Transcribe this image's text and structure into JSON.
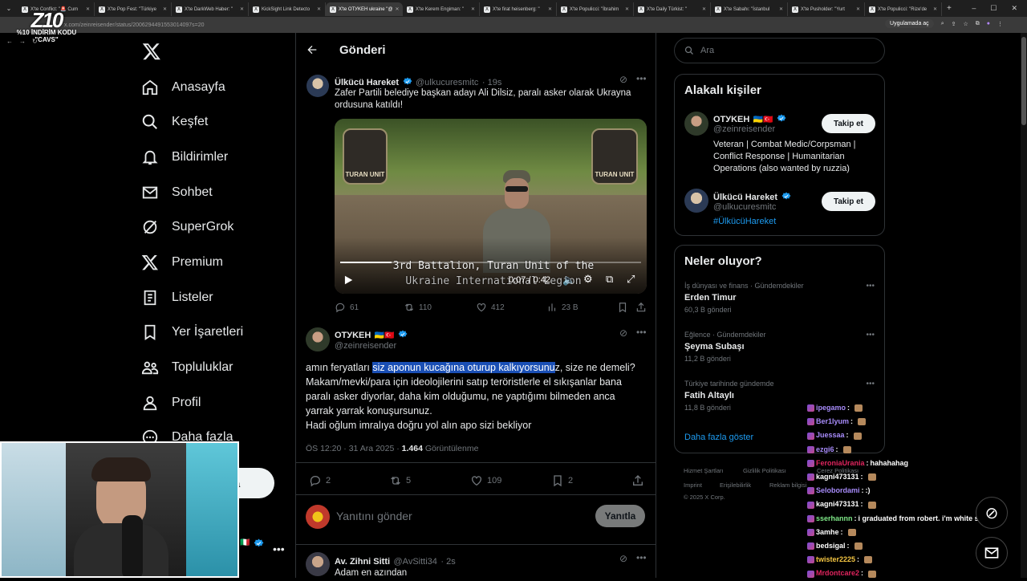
{
  "browser": {
    "tabs": [
      {
        "title": "X'te Conflict: \"🚨 Cum",
        "active": false
      },
      {
        "title": "X'te Pop Fest: \"Türkiye",
        "active": false
      },
      {
        "title": "X'te DarkWeb Haber: \"",
        "active": false
      },
      {
        "title": "KickSight Link Detecto",
        "active": false
      },
      {
        "title": "X'te OTУKEH ukraine \"@",
        "active": true
      },
      {
        "title": "X'te Kerem Engiman: \"",
        "active": false
      },
      {
        "title": "X'te firat heisenberg: \"",
        "active": false
      },
      {
        "title": "X'te Populicci: \"İbrahim",
        "active": false
      },
      {
        "title": "X'te Daily Türkist: \"",
        "active": false
      },
      {
        "title": "X'te Sabahı: \"İstanbul",
        "active": false
      },
      {
        "title": "X'te Pusholder: \"Yurt",
        "active": false
      },
      {
        "title": "X'te Populicci: \"Rize'de",
        "active": false
      }
    ],
    "url": "x.com/zeinreisender/status/2006294491553014097s=20",
    "apps_chip": "Uygulamada aç"
  },
  "overlay": {
    "logo_text": "Z10",
    "promo_line1": "%10 İNDİRİM KODU",
    "promo_line2": "\"CAVS\""
  },
  "nav": {
    "items": [
      {
        "label": "Anasayfa",
        "icon": "home-icon"
      },
      {
        "label": "Keşfet",
        "icon": "search-icon"
      },
      {
        "label": "Bildirimler",
        "icon": "bell-icon"
      },
      {
        "label": "Sohbet",
        "icon": "mail-icon"
      },
      {
        "label": "SuperGrok",
        "icon": "grok-icon"
      },
      {
        "label": "Premium",
        "icon": "x-icon"
      },
      {
        "label": "Listeler",
        "icon": "list-icon"
      },
      {
        "label": "Yer İşaretleri",
        "icon": "bookmark-icon"
      },
      {
        "label": "Topluluklar",
        "icon": "people-icon"
      },
      {
        "label": "Profil",
        "icon": "person-icon"
      },
      {
        "label": "Daha fazla",
        "icon": "more-circle-icon"
      }
    ],
    "post_button_partial": "a"
  },
  "main": {
    "title": "Gönderi",
    "quoted": {
      "name": "Ülkücü Hareket",
      "handle": "@ulkucuresmitc",
      "time": "19s",
      "text": "Zafer Partili belediye başkan adayı Ali Dilsiz, paralı asker olarak Ukrayna ordusuna katıldı!",
      "video": {
        "subtitle_line1": "3rd Battalion, Turan Unit of the",
        "subtitle_line2": "Ukraine International Legion",
        "time": "0:07 / 0:42",
        "patch_left": "TURAN UNIT",
        "patch_right": "TURAN UNIT",
        "progress": 0.17
      },
      "stats": {
        "replies": "61",
        "reposts": "110",
        "likes": "412",
        "views": "23 B"
      }
    },
    "post": {
      "name": "OTУKEH",
      "flags": "🇺🇦🇹🇷",
      "handle": "@zeinreisender",
      "text_before": "amın feryatları ",
      "text_highlight": "siz aponun kucağına oturup kalkıyorsunu",
      "text_after": "z, size ne demeli? Makam/mevki/para için ideolojilerini satıp teröristlerle el sıkışanlar bana paralı asker diyorlar, daha kim olduğumu, ne yaptığımı bilmeden anca yarrak yarrak konuşursunuz.",
      "text_line2": "Hadi oğlum imralıya doğru yol alın apo sizi bekliyor",
      "meta_time": "ÖS 12:20 · 31 Ara 2025 · ",
      "meta_views": "1.464",
      "meta_views_label": " Görüntülenme",
      "stats": {
        "replies": "2",
        "reposts": "5",
        "likes": "109",
        "bookmarks": "2"
      }
    },
    "reply_box": {
      "placeholder": "Yanıtını gönder",
      "button": "Yanıtla"
    },
    "reply": {
      "name": "Av. Zihni Sitti",
      "handle": "@AvSitti34",
      "time": "2s",
      "text": "Adam en azından"
    }
  },
  "right": {
    "search_placeholder": "Ara",
    "related": {
      "title": "Alakalı kişiler",
      "people": [
        {
          "name": "OTУKEH",
          "flags": "🇺🇦🇹🇷",
          "handle": "@zeinreisender",
          "bio": "Veteran | Combat Medic/Corpsman | Conflict Response | Humanitarian Operations (also wanted by ruzzia)",
          "button": "Takip et"
        },
        {
          "name": "Ülkücü Hareket",
          "flags": "",
          "handle": "@ulkucuresmitc",
          "bio": "#ÜlkücüHareket",
          "button": "Takip et"
        }
      ]
    },
    "trends": {
      "title": "Neler oluyor?",
      "items": [
        {
          "category": "İş dünyası ve finans · Gündemdekiler",
          "name": "Erden Timur",
          "count": "60,3 B gönderi"
        },
        {
          "category": "Eğlence · Gündemdekiler",
          "name": "Şeyma Subaşı",
          "count": "11,2 B gönderi"
        },
        {
          "category": "Türkiye tarihinde gündemde",
          "name": "Fatih Altaylı",
          "count": "11,8 B gönderi"
        }
      ],
      "show_more": "Daha fazla göster"
    },
    "footer": {
      "links": [
        "Hizmet Şartları",
        "Gizlilik Politikası",
        "Çerez Politikası",
        "Imprint",
        "Erişilebilirlik",
        "Reklam bilgisi"
      ],
      "copyright": "© 2025 X Corp."
    }
  },
  "chat": [
    {
      "user": "ipegamo",
      "color": "#a78bfa",
      "msg": ""
    },
    {
      "user": "Ber1lyum",
      "color": "#a78bfa",
      "msg": ""
    },
    {
      "user": "Juessaa",
      "color": "#a78bfa",
      "msg": ""
    },
    {
      "user": "ezgi6",
      "color": "#a78bfa",
      "msg": ""
    },
    {
      "user": "FeroniaUrania",
      "color": "#e0245e",
      "msg": "hahahahag"
    },
    {
      "user": "kagni473131",
      "color": "#ffffff",
      "msg": ""
    },
    {
      "user": "Selobordami",
      "color": "#a78bfa",
      "msg": ":)"
    },
    {
      "user": "kagni473131",
      "color": "#ffffff",
      "msg": ""
    },
    {
      "user": "sserhannn",
      "color": "#7ee787",
      "msg": "i graduated from robert. i'm white sir pls"
    },
    {
      "user": "3amhe",
      "color": "#ffffff",
      "msg": ""
    },
    {
      "user": "bedsigal",
      "color": "#ffffff",
      "msg": ""
    },
    {
      "user": "twister2225",
      "color": "#f4c542",
      "msg": ""
    },
    {
      "user": "Mrdontcare2",
      "color": "#e0245e",
      "msg": ""
    }
  ]
}
